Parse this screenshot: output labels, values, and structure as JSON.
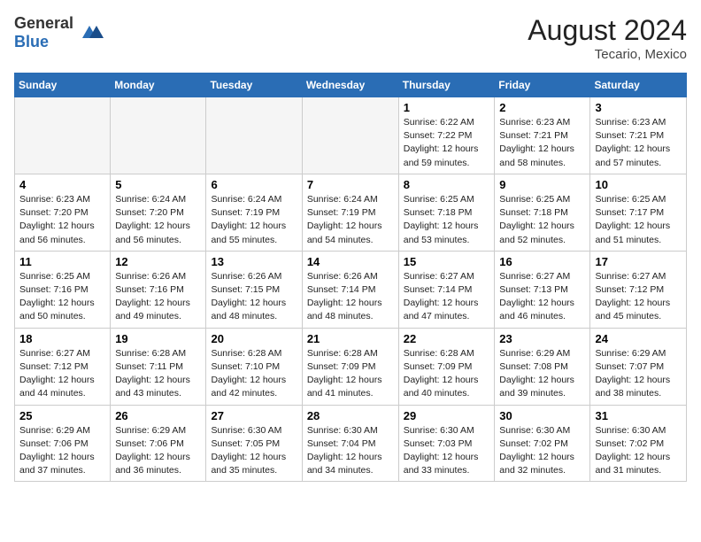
{
  "header": {
    "logo_general": "General",
    "logo_blue": "Blue",
    "month_year": "August 2024",
    "location": "Tecario, Mexico"
  },
  "weekdays": [
    "Sunday",
    "Monday",
    "Tuesday",
    "Wednesday",
    "Thursday",
    "Friday",
    "Saturday"
  ],
  "weeks": [
    [
      {
        "day": "",
        "info": ""
      },
      {
        "day": "",
        "info": ""
      },
      {
        "day": "",
        "info": ""
      },
      {
        "day": "",
        "info": ""
      },
      {
        "day": "1",
        "info": "Sunrise: 6:22 AM\nSunset: 7:22 PM\nDaylight: 12 hours\nand 59 minutes."
      },
      {
        "day": "2",
        "info": "Sunrise: 6:23 AM\nSunset: 7:21 PM\nDaylight: 12 hours\nand 58 minutes."
      },
      {
        "day": "3",
        "info": "Sunrise: 6:23 AM\nSunset: 7:21 PM\nDaylight: 12 hours\nand 57 minutes."
      }
    ],
    [
      {
        "day": "4",
        "info": "Sunrise: 6:23 AM\nSunset: 7:20 PM\nDaylight: 12 hours\nand 56 minutes."
      },
      {
        "day": "5",
        "info": "Sunrise: 6:24 AM\nSunset: 7:20 PM\nDaylight: 12 hours\nand 56 minutes."
      },
      {
        "day": "6",
        "info": "Sunrise: 6:24 AM\nSunset: 7:19 PM\nDaylight: 12 hours\nand 55 minutes."
      },
      {
        "day": "7",
        "info": "Sunrise: 6:24 AM\nSunset: 7:19 PM\nDaylight: 12 hours\nand 54 minutes."
      },
      {
        "day": "8",
        "info": "Sunrise: 6:25 AM\nSunset: 7:18 PM\nDaylight: 12 hours\nand 53 minutes."
      },
      {
        "day": "9",
        "info": "Sunrise: 6:25 AM\nSunset: 7:18 PM\nDaylight: 12 hours\nand 52 minutes."
      },
      {
        "day": "10",
        "info": "Sunrise: 6:25 AM\nSunset: 7:17 PM\nDaylight: 12 hours\nand 51 minutes."
      }
    ],
    [
      {
        "day": "11",
        "info": "Sunrise: 6:25 AM\nSunset: 7:16 PM\nDaylight: 12 hours\nand 50 minutes."
      },
      {
        "day": "12",
        "info": "Sunrise: 6:26 AM\nSunset: 7:16 PM\nDaylight: 12 hours\nand 49 minutes."
      },
      {
        "day": "13",
        "info": "Sunrise: 6:26 AM\nSunset: 7:15 PM\nDaylight: 12 hours\nand 48 minutes."
      },
      {
        "day": "14",
        "info": "Sunrise: 6:26 AM\nSunset: 7:14 PM\nDaylight: 12 hours\nand 48 minutes."
      },
      {
        "day": "15",
        "info": "Sunrise: 6:27 AM\nSunset: 7:14 PM\nDaylight: 12 hours\nand 47 minutes."
      },
      {
        "day": "16",
        "info": "Sunrise: 6:27 AM\nSunset: 7:13 PM\nDaylight: 12 hours\nand 46 minutes."
      },
      {
        "day": "17",
        "info": "Sunrise: 6:27 AM\nSunset: 7:12 PM\nDaylight: 12 hours\nand 45 minutes."
      }
    ],
    [
      {
        "day": "18",
        "info": "Sunrise: 6:27 AM\nSunset: 7:12 PM\nDaylight: 12 hours\nand 44 minutes."
      },
      {
        "day": "19",
        "info": "Sunrise: 6:28 AM\nSunset: 7:11 PM\nDaylight: 12 hours\nand 43 minutes."
      },
      {
        "day": "20",
        "info": "Sunrise: 6:28 AM\nSunset: 7:10 PM\nDaylight: 12 hours\nand 42 minutes."
      },
      {
        "day": "21",
        "info": "Sunrise: 6:28 AM\nSunset: 7:09 PM\nDaylight: 12 hours\nand 41 minutes."
      },
      {
        "day": "22",
        "info": "Sunrise: 6:28 AM\nSunset: 7:09 PM\nDaylight: 12 hours\nand 40 minutes."
      },
      {
        "day": "23",
        "info": "Sunrise: 6:29 AM\nSunset: 7:08 PM\nDaylight: 12 hours\nand 39 minutes."
      },
      {
        "day": "24",
        "info": "Sunrise: 6:29 AM\nSunset: 7:07 PM\nDaylight: 12 hours\nand 38 minutes."
      }
    ],
    [
      {
        "day": "25",
        "info": "Sunrise: 6:29 AM\nSunset: 7:06 PM\nDaylight: 12 hours\nand 37 minutes."
      },
      {
        "day": "26",
        "info": "Sunrise: 6:29 AM\nSunset: 7:06 PM\nDaylight: 12 hours\nand 36 minutes."
      },
      {
        "day": "27",
        "info": "Sunrise: 6:30 AM\nSunset: 7:05 PM\nDaylight: 12 hours\nand 35 minutes."
      },
      {
        "day": "28",
        "info": "Sunrise: 6:30 AM\nSunset: 7:04 PM\nDaylight: 12 hours\nand 34 minutes."
      },
      {
        "day": "29",
        "info": "Sunrise: 6:30 AM\nSunset: 7:03 PM\nDaylight: 12 hours\nand 33 minutes."
      },
      {
        "day": "30",
        "info": "Sunrise: 6:30 AM\nSunset: 7:02 PM\nDaylight: 12 hours\nand 32 minutes."
      },
      {
        "day": "31",
        "info": "Sunrise: 6:30 AM\nSunset: 7:02 PM\nDaylight: 12 hours\nand 31 minutes."
      }
    ]
  ]
}
